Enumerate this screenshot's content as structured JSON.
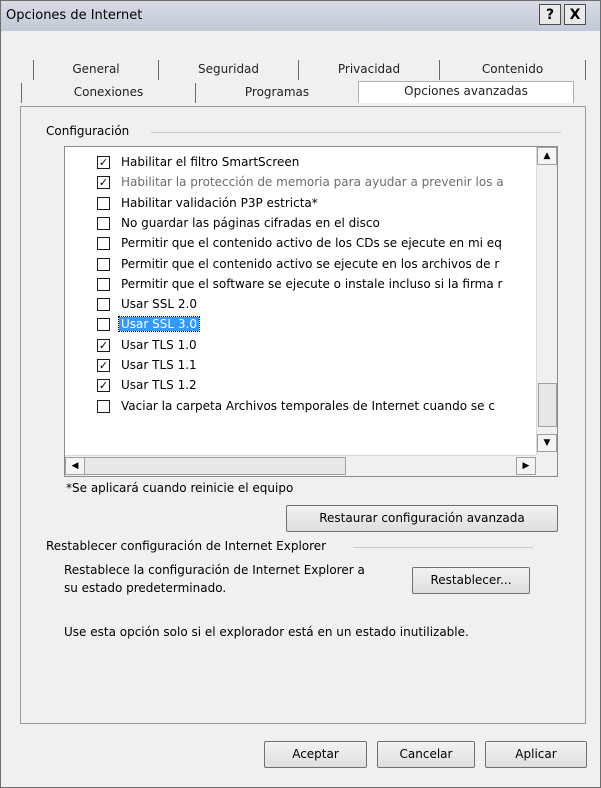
{
  "window": {
    "title": "Opciones de Internet",
    "help_label": "?",
    "close_label": "X"
  },
  "tabs": {
    "row1": [
      "General",
      "Seguridad",
      "Privacidad",
      "Contenido"
    ],
    "row2": [
      "Conexiones",
      "Programas",
      "Opciones avanzadas"
    ],
    "active": "Opciones avanzadas"
  },
  "settings": {
    "group_label": "Configuración",
    "items": [
      {
        "label": "Habilitar el filtro SmartScreen",
        "checked": true,
        "dim": false,
        "selected": false
      },
      {
        "label": "Habilitar la protección de memoria para ayudar a prevenir los a",
        "checked": true,
        "dim": true,
        "selected": false
      },
      {
        "label": "Habilitar validación P3P estricta*",
        "checked": false,
        "dim": false,
        "selected": false
      },
      {
        "label": "No guardar las páginas cifradas en el disco",
        "checked": false,
        "dim": false,
        "selected": false
      },
      {
        "label": "Permitir que el contenido activo de los CDs se ejecute en mi eq",
        "checked": false,
        "dim": false,
        "selected": false
      },
      {
        "label": "Permitir que el contenido activo se ejecute en los archivos de r",
        "checked": false,
        "dim": false,
        "selected": false
      },
      {
        "label": "Permitir que el software se ejecute o instale incluso si la firma r",
        "checked": false,
        "dim": false,
        "selected": false
      },
      {
        "label": "Usar SSL 2.0",
        "checked": false,
        "dim": false,
        "selected": false
      },
      {
        "label": "Usar SSL 3.0",
        "checked": false,
        "dim": false,
        "selected": true
      },
      {
        "label": "Usar TLS 1.0",
        "checked": true,
        "dim": false,
        "selected": false
      },
      {
        "label": "Usar TLS 1.1",
        "checked": true,
        "dim": false,
        "selected": false
      },
      {
        "label": "Usar TLS 1.2",
        "checked": true,
        "dim": false,
        "selected": false
      },
      {
        "label": "Vaciar la carpeta Archivos temporales de Internet cuando se c",
        "checked": false,
        "dim": false,
        "selected": false
      }
    ],
    "note": "*Se aplicará cuando reinicie el equipo",
    "restore_label": "Restaurar configuración avanzada"
  },
  "reset": {
    "group_label": "Restablecer configuración de Internet Explorer",
    "desc_line1": "Restablece la configuración de Internet Explorer a",
    "desc_line2": "su estado predeterminado.",
    "button_label": "Restablecer...",
    "warning": "Use esta opción solo si el explorador está en un estado inutilizable."
  },
  "footer": {
    "ok_label": "Aceptar",
    "cancel_label": "Cancelar",
    "apply_label": "Aplicar"
  }
}
